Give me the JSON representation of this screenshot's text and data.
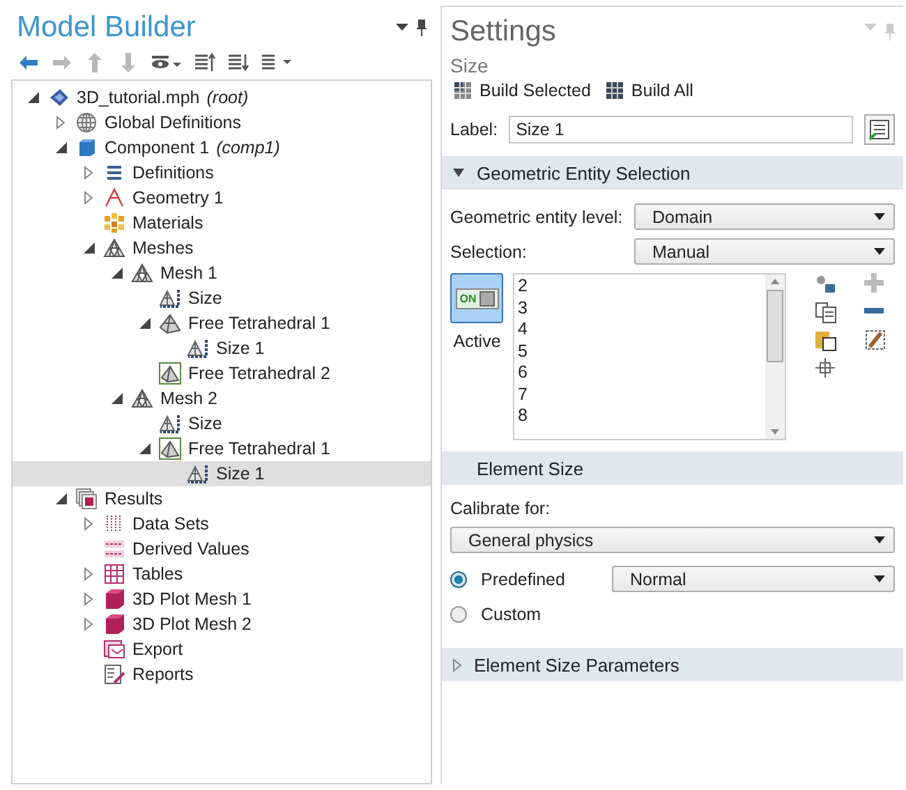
{
  "model_builder": {
    "title": "Model Builder",
    "toolbar": [
      {
        "kind": "back",
        "disabled": false
      },
      {
        "kind": "forward",
        "disabled": true
      },
      {
        "kind": "up",
        "disabled": true
      },
      {
        "kind": "down",
        "disabled": true
      },
      {
        "kind": "view",
        "disabled": false
      },
      {
        "kind": "move-up",
        "disabled": false
      },
      {
        "kind": "move-down",
        "disabled": false
      },
      {
        "kind": "list",
        "disabled": false
      }
    ],
    "tree": [
      {
        "label": "3D_tutorial.mph",
        "note": "(root)",
        "kind": "file",
        "expanded": true,
        "selected": false,
        "children": [
          {
            "label": "Global Definitions",
            "kind": "globe",
            "expanded": false,
            "selected": false
          },
          {
            "label": "Component 1",
            "note": "(comp1)",
            "kind": "component",
            "expanded": true,
            "selected": false,
            "children": [
              {
                "label": "Definitions",
                "kind": "lines",
                "expanded": false,
                "selected": false
              },
              {
                "label": "Geometry 1",
                "kind": "geometry",
                "expanded": false,
                "selected": false
              },
              {
                "label": "Materials",
                "kind": "materials",
                "selected": false
              },
              {
                "label": "Meshes",
                "kind": "mesh",
                "expanded": true,
                "selected": false,
                "children": [
                  {
                    "label": "Mesh 1",
                    "kind": "mesh",
                    "expanded": true,
                    "selected": false,
                    "children": [
                      {
                        "label": "Size",
                        "kind": "size",
                        "selected": false
                      },
                      {
                        "label": "Free Tetrahedral 1",
                        "kind": "tetra",
                        "expanded": true,
                        "selected": false,
                        "children": [
                          {
                            "label": "Size 1",
                            "kind": "size",
                            "selected": false
                          }
                        ]
                      },
                      {
                        "label": "Free Tetrahedral 2",
                        "kind": "tetra-framed",
                        "selected": false
                      }
                    ]
                  },
                  {
                    "label": "Mesh 2",
                    "kind": "mesh",
                    "expanded": true,
                    "selected": false,
                    "children": [
                      {
                        "label": "Size",
                        "kind": "size",
                        "selected": false
                      },
                      {
                        "label": "Free Tetrahedral 1",
                        "kind": "tetra-framed",
                        "expanded": true,
                        "selected": false,
                        "children": [
                          {
                            "label": "Size 1",
                            "kind": "size",
                            "selected": true
                          }
                        ]
                      }
                    ]
                  }
                ]
              }
            ]
          },
          {
            "label": "Results",
            "kind": "results",
            "expanded": true,
            "selected": false,
            "children": [
              {
                "label": "Data Sets",
                "kind": "datasets",
                "expanded": false,
                "selected": false
              },
              {
                "label": "Derived Values",
                "kind": "derived",
                "selected": false
              },
              {
                "label": "Tables",
                "kind": "tables",
                "expanded": false,
                "selected": false
              },
              {
                "label": "3D Plot Mesh 1",
                "kind": "plot",
                "expanded": false,
                "selected": false
              },
              {
                "label": "3D Plot Mesh 2",
                "kind": "plot",
                "expanded": false,
                "selected": false
              },
              {
                "label": "Export",
                "kind": "export",
                "selected": false
              },
              {
                "label": "Reports",
                "kind": "reports",
                "selected": false
              }
            ]
          }
        ]
      }
    ]
  },
  "settings": {
    "title": "Settings",
    "subtitle": "Size",
    "actions": [
      {
        "kind": "build-selected",
        "label": "Build Selected"
      },
      {
        "kind": "build-all",
        "label": "Build All"
      }
    ],
    "label_field": {
      "label": "Label:",
      "value": "Size 1"
    },
    "sections": [
      {
        "kind": "selection",
        "title": "Geometric Entity Selection",
        "expanded": true,
        "level_label": "Geometric entity level:",
        "level_value": "Domain",
        "selection_label": "Selection:",
        "selection_value": "Manual",
        "active": {
          "text": "ON",
          "label": "Active",
          "on": true
        },
        "items": [
          "2",
          "3",
          "4",
          "5",
          "6",
          "7",
          "8"
        ]
      },
      {
        "kind": "size",
        "title": "Element Size",
        "calibrate_label": "Calibrate for:",
        "calibrate_value": "General physics",
        "options": [
          {
            "label": "Predefined",
            "selected": true,
            "value": "Normal"
          },
          {
            "label": "Custom",
            "selected": false
          }
        ]
      },
      {
        "kind": "params",
        "title": "Element Size Parameters",
        "expanded": false
      }
    ]
  }
}
